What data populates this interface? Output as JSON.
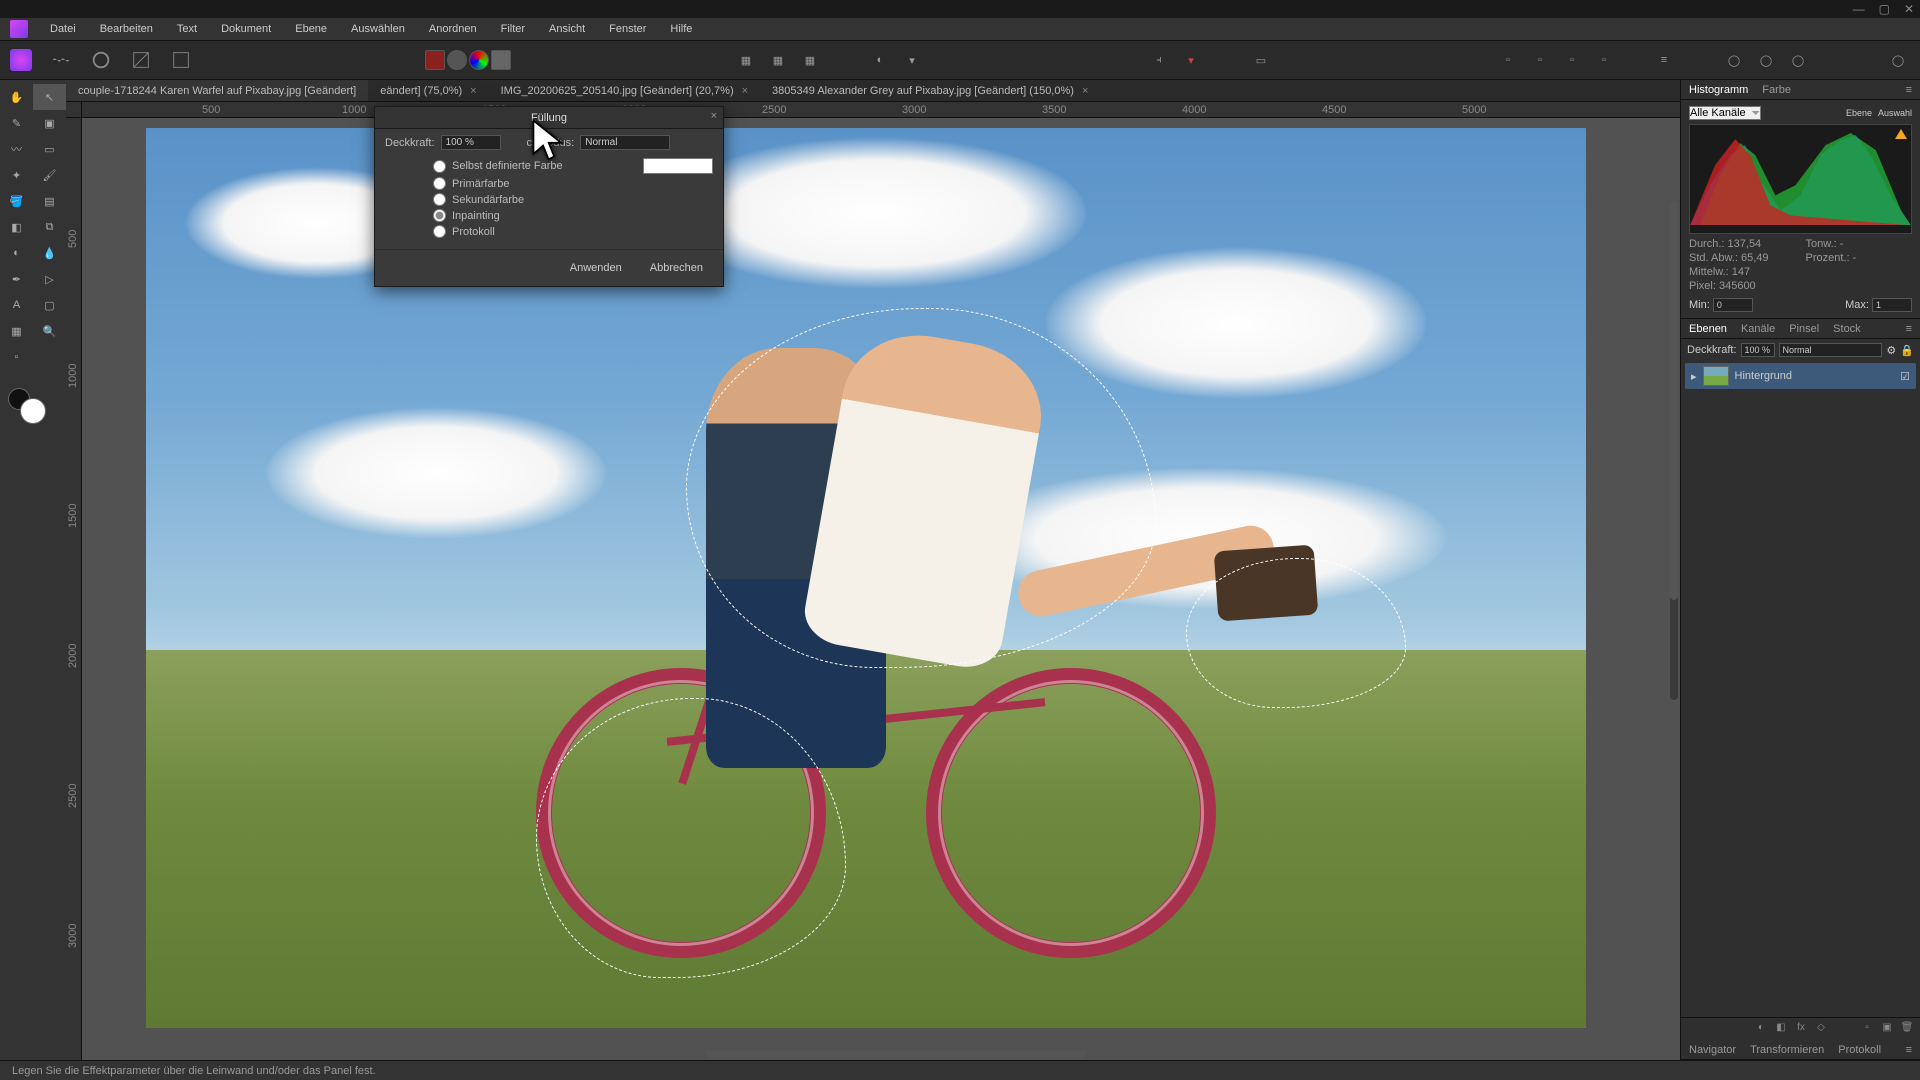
{
  "menu": {
    "items": [
      "Datei",
      "Bearbeiten",
      "Text",
      "Dokument",
      "Ebene",
      "Auswählen",
      "Anordnen",
      "Filter",
      "Ansicht",
      "Fenster",
      "Hilfe"
    ]
  },
  "tabs": [
    {
      "label": "couple-1718244 Karen Warfel auf Pixabay.jpg [Geändert]",
      "active": true
    },
    {
      "label": "eändert] (75,0%)",
      "active": false
    },
    {
      "label": "IMG_20200625_205140.jpg [Geändert] (20,7%)",
      "active": false
    },
    {
      "label": "3805349 Alexander Grey auf Pixabay.jpg [Geändert] (150,0%)",
      "active": false
    }
  ],
  "dialog": {
    "title": "Füllung",
    "opacity_label": "Deckkraft:",
    "opacity_value": "100 %",
    "blend_label": "chmodus:",
    "blend_value": "Normal",
    "options": [
      {
        "label": "Selbst definierte Farbe",
        "selected": false,
        "hasColor": true
      },
      {
        "label": "Primärfarbe",
        "selected": false
      },
      {
        "label": "Sekundärfarbe",
        "selected": false
      },
      {
        "label": "Inpainting",
        "selected": true
      },
      {
        "label": "Protokoll",
        "selected": false
      }
    ],
    "apply": "Anwenden",
    "cancel": "Abbrechen"
  },
  "panels": {
    "top_tabs": {
      "histogram": "Histogramm",
      "color": "Farbe"
    },
    "channel_label": "Alle Kanäle",
    "ebene_btn": "Ebene",
    "auswahl_btn": "Auswahl",
    "stats": {
      "mean_l": "Durch.:",
      "mean_v": "137,54",
      "std_l": "Std. Abw.:",
      "std_v": "65,49",
      "med_l": "Mittelw.:",
      "med_v": "147",
      "px_l": "Pixel:",
      "px_v": "345600",
      "tone_l": "Tonw.:",
      "tone_v": "-",
      "pct_l": "Prozent.:",
      "pct_v": "-"
    },
    "min_l": "Min:",
    "min_v": "0",
    "max_l": "Max:",
    "max_v": "1",
    "mid_tabs": [
      "Ebenen",
      "Kanäle",
      "Pinsel",
      "Stock"
    ],
    "layer_opacity_l": "Deckkraft:",
    "layer_opacity_v": "100 %",
    "layer_blend": "Normal",
    "layer_name": "Hintergrund",
    "bottom_tabs": [
      "Navigator",
      "Transformieren",
      "Protokoll"
    ]
  },
  "status": "Legen Sie die Effektparameter über die Leinwand und/oder das Panel fest.",
  "ruler_h": [
    "500",
    "1000",
    "1500",
    "2000",
    "2500",
    "3000",
    "3500",
    "4000",
    "4500",
    "5000"
  ],
  "ruler_v": [
    "500",
    "1000",
    "1500",
    "2000",
    "2500",
    "3000"
  ]
}
